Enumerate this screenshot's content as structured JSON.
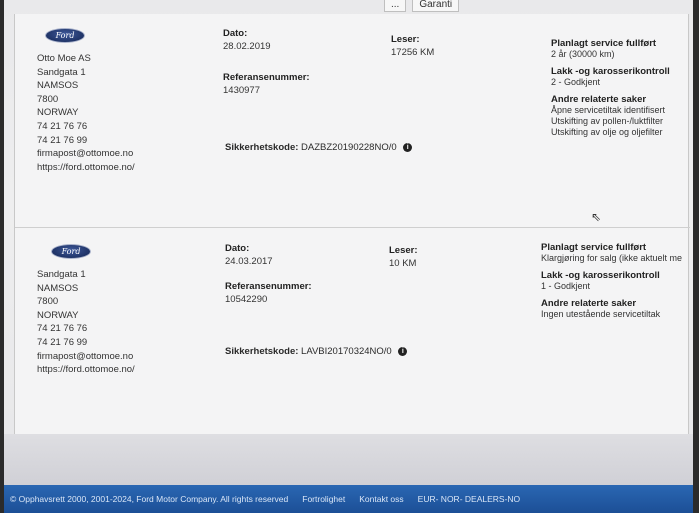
{
  "topbar": {
    "tab1": "...",
    "tab2": "Garanti"
  },
  "cards": [
    {
      "dealer": {
        "logo_text": "Ford",
        "name": "Otto Moe AS",
        "street": "Sandgata 1",
        "city": "NAMSOS",
        "zip": "7800",
        "country": "NORWAY",
        "phone1": "74 21 76 76",
        "phone2": "74 21 76 99",
        "email": "firmapost@ottomoe.no",
        "url": "https://ford.ottomoe.no/"
      },
      "date_label": "Dato:",
      "date": "28.02.2019",
      "reading_label": "Leser:",
      "reading": "17256 KM",
      "ref_label": "Referansenummer:",
      "ref": "1430977",
      "sec_label": "Sikkerhetskode:",
      "sec": "DAZBZ20190228NO/0",
      "service_label": "Planlagt service fullført",
      "service": "2 år (30000 km)",
      "paint_label": "Lakk -og karosserikontroll",
      "paint": "2 - Godkjent",
      "other_label": "Andre relaterte saker",
      "other": [
        "Åpne servicetiltak identifisert",
        "Utskifting av pollen-/luktfilter",
        "Utskifting av olje og oljefilter"
      ]
    },
    {
      "dealer": {
        "logo_text": "Ford",
        "street": "Sandgata 1",
        "city": "NAMSOS",
        "zip": "7800",
        "country": "NORWAY",
        "phone1": "74 21 76 76",
        "phone2": "74 21 76 99",
        "email": "firmapost@ottomoe.no",
        "url": "https://ford.ottomoe.no/"
      },
      "date_label": "Dato:",
      "date": "24.03.2017",
      "reading_label": "Leser:",
      "reading": "10 KM",
      "ref_label": "Referansenummer:",
      "ref": "10542290",
      "sec_label": "Sikkerhetskode:",
      "sec": "LAVBI20170324NO/0",
      "service_label": "Planlagt service fullført",
      "service": "Klargjøring for salg (ikke aktuelt me",
      "paint_label": "Lakk -og karosserikontroll",
      "paint": "1 - Godkjent",
      "other_label": "Andre relaterte saker",
      "other": [
        "Ingen utestående servicetiltak"
      ]
    }
  ],
  "footer": {
    "copyright": "© Opphavsrett 2000, 2001-2024, Ford Motor Company. All rights reserved",
    "privacy": "Fortrolighet",
    "contact": "Kontakt oss",
    "region": "EUR- NOR- DEALERS-NO"
  }
}
